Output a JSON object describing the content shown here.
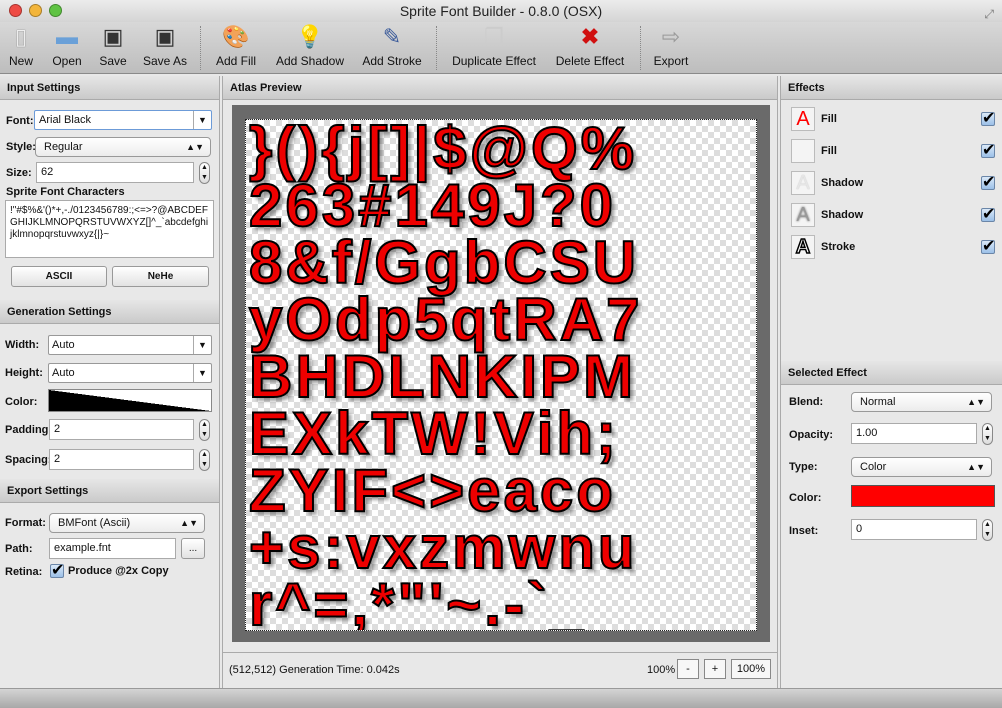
{
  "window": {
    "title": "Sprite Font Builder - 0.8.0 (OSX)"
  },
  "toolbar": [
    {
      "label": "New",
      "icon": "new-document-icon"
    },
    {
      "label": "Open",
      "icon": "open-icon"
    },
    {
      "label": "Save",
      "icon": "save-icon"
    },
    {
      "label": "Save As",
      "icon": "save-as-icon"
    },
    {
      "label": "Add Fill",
      "icon": "add-fill-icon"
    },
    {
      "label": "Add Shadow",
      "icon": "add-shadow-icon"
    },
    {
      "label": "Add Stroke",
      "icon": "add-stroke-icon"
    },
    {
      "label": "Duplicate Effect",
      "icon": "duplicate-icon"
    },
    {
      "label": "Delete Effect",
      "icon": "delete-icon"
    },
    {
      "label": "Export",
      "icon": "export-icon"
    }
  ],
  "input": {
    "header": "Input Settings",
    "font_label": "Font:",
    "font": "Arial Black",
    "style_label": "Style:",
    "style": "Regular",
    "size_label": "Size:",
    "size": "62",
    "chars_label": "Sprite Font Characters",
    "chars": " !\"#$%&'()*+,-./0123456789:;<=>?@ABCDEFGHIJKLMNOPQRSTUVWXYZ[]^_`abcdefghijklmnopqrstuvwxyz{|}~",
    "ascii": "ASCII",
    "nehe": "NeHe"
  },
  "generation": {
    "header": "Generation Settings",
    "width_label": "Width:",
    "width": "Auto",
    "height_label": "Height:",
    "height": "Auto",
    "color_label": "Color:",
    "padding_label": "Padding:",
    "padding": "2",
    "spacing_label": "Spacing:",
    "spacing": "2"
  },
  "export": {
    "header": "Export Settings",
    "format_label": "Format:",
    "format": "BMFont (Ascii)",
    "path_label": "Path:",
    "path": "example.fnt",
    "browse": "...",
    "retina_label": "Retina:",
    "retina_option": "Produce @2x Copy",
    "retina_checked": true
  },
  "atlas": {
    "header": "Atlas Preview",
    "rows": [
      [
        "}",
        "(",
        ")",
        "{",
        "j",
        "[",
        "]",
        "|",
        "$",
        "@",
        "Q",
        "%"
      ],
      [
        "2",
        "6",
        "3",
        "#",
        "1",
        "4",
        "9",
        "J",
        "?",
        "0"
      ],
      [
        "8",
        "&",
        "f",
        "/",
        "G",
        "g",
        "b",
        "C",
        "S",
        "U"
      ],
      [
        "y",
        "O",
        "d",
        "p",
        "5",
        "q",
        "t",
        "R",
        "A",
        "7"
      ],
      [
        "B",
        "H",
        "D",
        "L",
        "N",
        "K",
        "I",
        "P",
        "M"
      ],
      [
        "E",
        "X",
        "k",
        "T",
        "W",
        "!",
        "V",
        "i",
        "h",
        ";"
      ],
      [
        "Z",
        "Y",
        "I",
        "F",
        "<",
        ">",
        "e",
        "a",
        "c",
        "o"
      ],
      [
        "+",
        "s",
        ":",
        "v",
        "x",
        "z",
        "m",
        "w",
        "n",
        "u"
      ],
      [
        "r",
        "^",
        "=",
        ",",
        "*",
        "\"",
        "'",
        "~",
        ".",
        "-",
        "`",
        "_"
      ]
    ],
    "status": "(512,512) Generation Time: 0.042s",
    "zoom": "100%",
    "zoom_out": "-",
    "zoom_in": "+",
    "zoom_reset": "100%"
  },
  "effects": {
    "header": "Effects",
    "items": [
      {
        "name": "Fill",
        "checked": true
      },
      {
        "name": "Fill",
        "checked": true
      },
      {
        "name": "Shadow",
        "checked": true
      },
      {
        "name": "Shadow",
        "checked": true
      },
      {
        "name": "Stroke",
        "checked": true
      }
    ]
  },
  "selected": {
    "header": "Selected Effect",
    "blend_label": "Blend:",
    "blend": "Normal",
    "opacity_label": "Opacity:",
    "opacity": "1.00",
    "type_label": "Type:",
    "type": "Color",
    "color_label": "Color:",
    "color": "#ff0000",
    "inset_label": "Inset:",
    "inset": "0"
  }
}
